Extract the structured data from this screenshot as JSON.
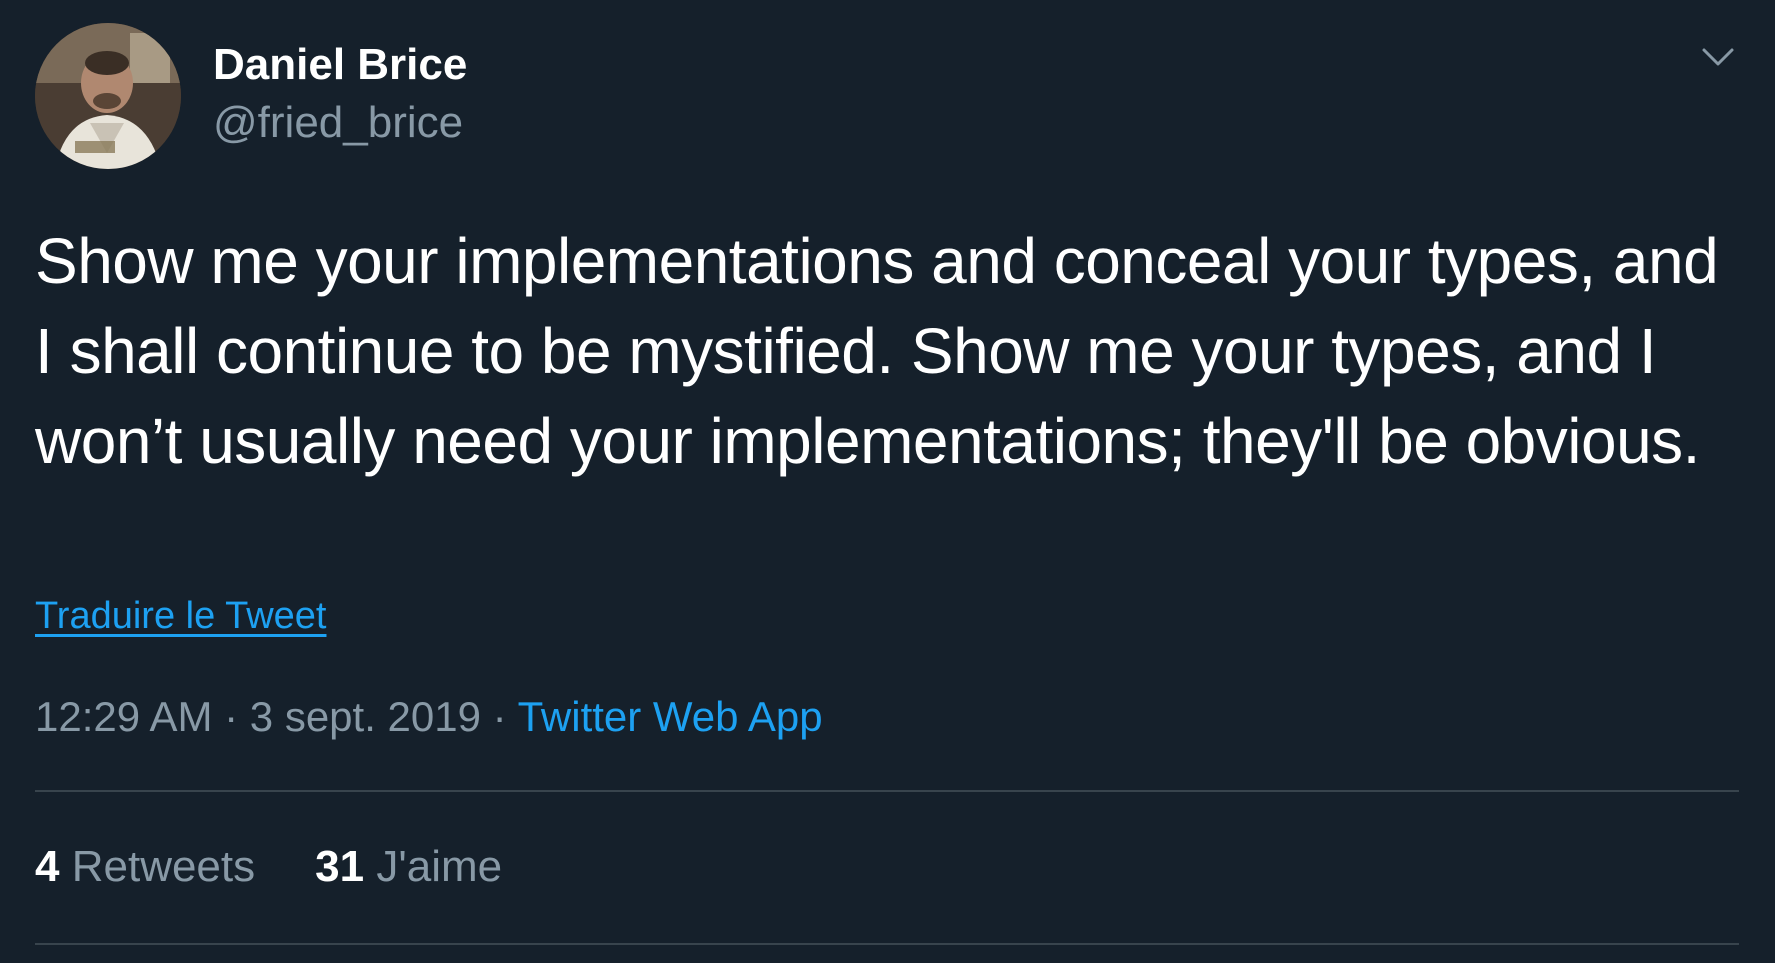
{
  "author": {
    "name": "Daniel Brice",
    "handle": "@fried_brice",
    "avatar_icon": "profile-photo"
  },
  "menu": {
    "icon": "chevron-down-icon"
  },
  "tweet": {
    "text": "Show me your implementations and conceal your types, and I shall continue to be mystified. Show me your types, and I won’t usually need your implementations; they'll be obvious.",
    "translate_label": "Traduire le Tweet"
  },
  "meta": {
    "time": "12:29 AM",
    "separator1": " · ",
    "date": "3 sept. 2019",
    "separator2": " · ",
    "source": "Twitter Web App"
  },
  "stats": {
    "retweets_count": "4",
    "retweets_label": "Retweets",
    "likes_count": "31",
    "likes_label": "J'aime"
  },
  "colors": {
    "background": "#15202b",
    "primary_text": "#ffffff",
    "secondary_text": "#8899a6",
    "accent": "#1da1f2",
    "divider": "#38444d"
  }
}
